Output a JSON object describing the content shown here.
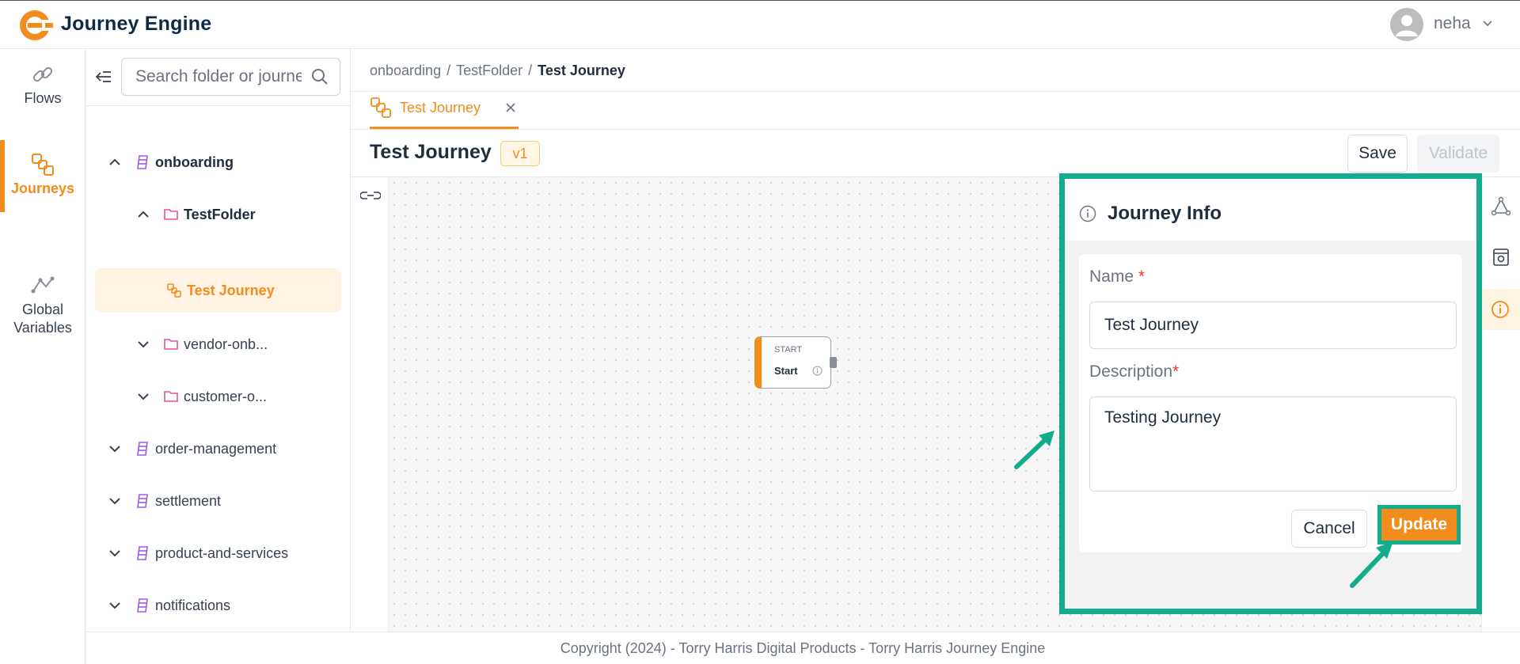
{
  "app": {
    "title": "Journey Engine",
    "user": "neha"
  },
  "rail": {
    "items": [
      {
        "label": "Flows",
        "icon": "link-icon"
      },
      {
        "label": "Journeys",
        "icon": "journey-icon"
      },
      {
        "label": "Global\nVariables",
        "icon": "graph-icon"
      }
    ]
  },
  "tree": {
    "search_placeholder": "Search folder or journey",
    "items": [
      {
        "label": "onboarding",
        "type": "repository",
        "expanded": true
      },
      {
        "label": "TestFolder",
        "type": "folder",
        "expanded": true
      },
      {
        "label": "Test Journey",
        "type": "journey",
        "selected": true
      },
      {
        "label": "vendor-onb...",
        "type": "folder",
        "expanded": false
      },
      {
        "label": "customer-o...",
        "type": "folder",
        "expanded": false
      },
      {
        "label": "order-management",
        "type": "repository",
        "expanded": false
      },
      {
        "label": "settlement",
        "type": "repository",
        "expanded": false
      },
      {
        "label": "product-and-services",
        "type": "repository",
        "expanded": false
      },
      {
        "label": "notifications",
        "type": "repository",
        "expanded": false
      }
    ]
  },
  "breadcrumb": [
    "onboarding",
    "TestFolder",
    "Test Journey"
  ],
  "tab": {
    "label": "Test Journey"
  },
  "header": {
    "title": "Test Journey",
    "version": "v1",
    "save_label": "Save",
    "validate_label": "Validate"
  },
  "canvas": {
    "node": {
      "type": "START",
      "name": "Start"
    }
  },
  "panel": {
    "title": "Journey Info",
    "name_label": "Name",
    "name_value": "Test Journey",
    "description_label": "Description",
    "description_value": "Testing Journey",
    "required_mark": "*",
    "cancel_label": "Cancel",
    "update_label": "Update"
  },
  "footer": {
    "text": "Copyright (2024) - Torry Harris Digital Products - Torry Harris Journey Engine"
  },
  "colors": {
    "accent": "#f28c1c",
    "highlight": "#13ad8e",
    "text": "#1f2d3d",
    "required": "#e53935"
  }
}
